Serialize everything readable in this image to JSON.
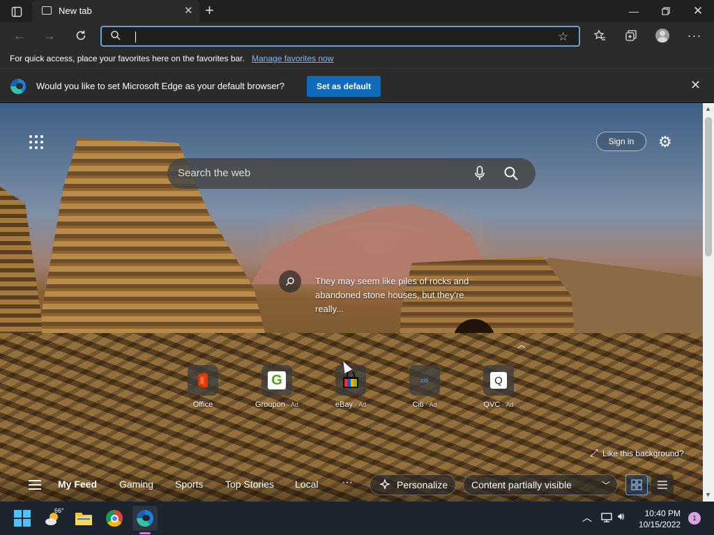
{
  "tab": {
    "title": "New tab"
  },
  "address_bar": {
    "value": "",
    "placeholder": ""
  },
  "favorites_bar": {
    "message": "For quick access, place your favorites here on the favorites bar.",
    "link": "Manage favorites now"
  },
  "default_banner": {
    "message": "Would you like to set Microsoft Edge as your default browser?",
    "button": "Set as default"
  },
  "newtab": {
    "sign_in": "Sign in",
    "search_placeholder": "Search the web",
    "image_caption": "They may seem like piles of rocks and abandoned stone houses, but they're really...",
    "like_background": "Like this background?",
    "quick_links": [
      {
        "name": "Office",
        "ad": ""
      },
      {
        "name": "Groupon",
        "ad": "· Ad"
      },
      {
        "name": "eBay",
        "ad": "· Ad"
      },
      {
        "name": "Citi",
        "ad": "· Ad"
      },
      {
        "name": "QVC",
        "ad": "· Ad"
      }
    ],
    "feed": {
      "items": [
        "My Feed",
        "Gaming",
        "Sports",
        "Top Stories",
        "Local"
      ],
      "more": "···",
      "personalize": "Personalize",
      "content_visibility": "Content partially visible"
    }
  },
  "taskbar": {
    "weather_temp": "66°",
    "time": "10:40 PM",
    "date": "10/15/2022",
    "notification_count": "1"
  },
  "colors": {
    "accent": "#0f6cbd",
    "link": "#7cb6ff",
    "address_focus": "#6aa0d8"
  }
}
